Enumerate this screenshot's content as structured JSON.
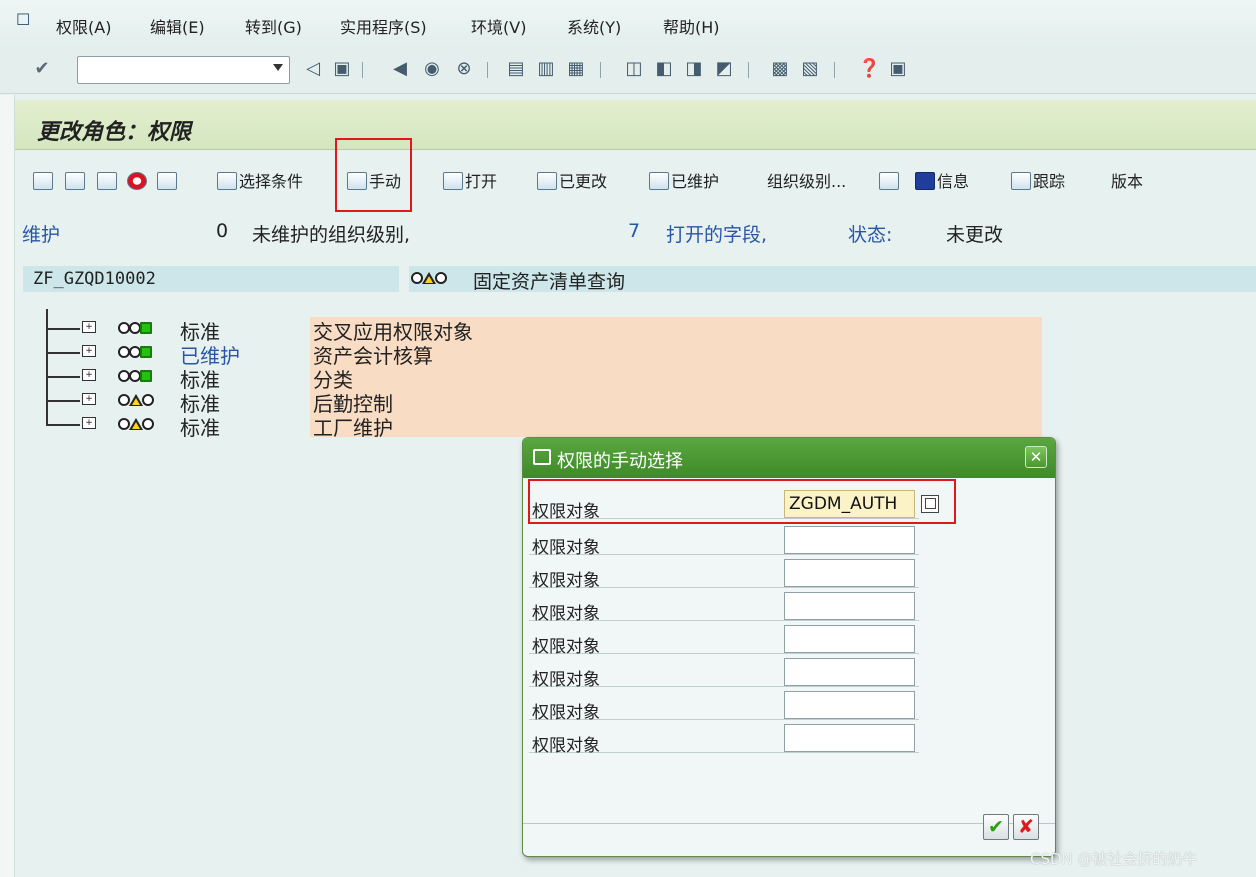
{
  "menu": {
    "items": [
      {
        "label": "权限(A)"
      },
      {
        "label": "编辑(E)"
      },
      {
        "label": "转到(G)"
      },
      {
        "label": "实用程序(S)"
      },
      {
        "label": "环境(V)"
      },
      {
        "label": "系统(Y)"
      },
      {
        "label": "帮助(H)"
      }
    ]
  },
  "toolbar": {
    "command_field": ""
  },
  "title": "更改角色：权限",
  "app_toolbar": {
    "select_criteria": "选择条件",
    "manual": "手动",
    "open": "打开",
    "changed": "已更改",
    "maintained": "已维护",
    "org_levels": "组织级别...",
    "info": "信息",
    "trace": "跟踪",
    "version": "版本"
  },
  "status_line": {
    "maintain": "维护",
    "unmaintained_count": "0",
    "unmaintained_text": "未维护的组织级别,",
    "open_count": "7",
    "open_text": "打开的字段,",
    "status_label": "状态:",
    "status_value": "未更改"
  },
  "role": {
    "code": "ZF_GZQD10002",
    "description": "固定资产清单查询"
  },
  "tree": {
    "rows": [
      {
        "status": "标准",
        "description": "交叉应用权限对象",
        "lights": "green"
      },
      {
        "status": "已维护",
        "description": "资产会计核算",
        "lights": "green"
      },
      {
        "status": "标准",
        "description": "分类",
        "lights": "green"
      },
      {
        "status": "标准",
        "description": "后勤控制",
        "lights": "yellow"
      },
      {
        "status": "标准",
        "description": "工厂维护",
        "lights": "yellow"
      }
    ]
  },
  "dialog": {
    "title": "权限的手动选择",
    "rows": [
      {
        "label": "权限对象",
        "value": "ZGDM_AUTH"
      },
      {
        "label": "权限对象",
        "value": ""
      },
      {
        "label": "权限对象",
        "value": ""
      },
      {
        "label": "权限对象",
        "value": ""
      },
      {
        "label": "权限对象",
        "value": ""
      },
      {
        "label": "权限对象",
        "value": ""
      },
      {
        "label": "权限对象",
        "value": ""
      },
      {
        "label": "权限对象",
        "value": ""
      }
    ]
  },
  "watermark": "CSDN @被社会挤的奶牛"
}
